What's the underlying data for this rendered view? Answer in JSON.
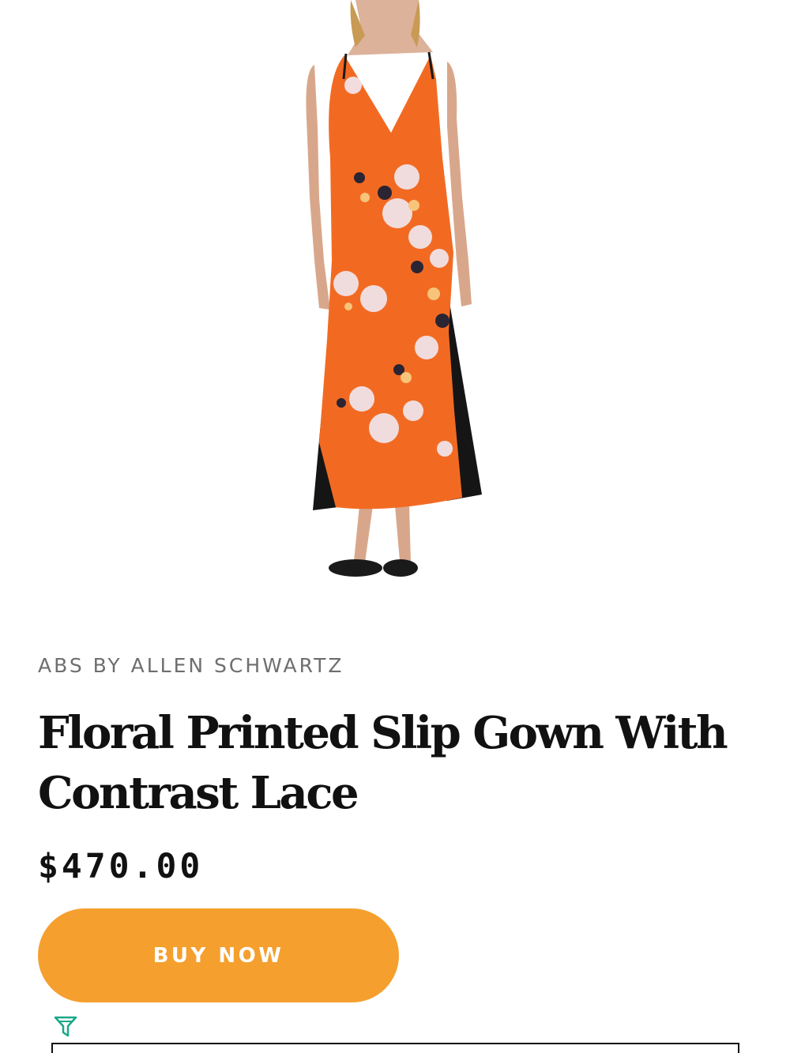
{
  "product": {
    "image_alt": "Woman wearing an orange floral printed slip gown with black lace side panels",
    "brand": "ABS BY ALLEN SCHWARTZ",
    "title": "Floral Printed Slip Gown With Contrast Lace",
    "price": "$470.00",
    "buy_label": "BUY NOW"
  },
  "colors": {
    "accent": "#f59f2e",
    "dress": "#f26a22",
    "lace": "#151515",
    "brand_text": "#6e6e6e",
    "icon": "#1aa789"
  },
  "icons": {
    "filter": "filter-icon"
  }
}
